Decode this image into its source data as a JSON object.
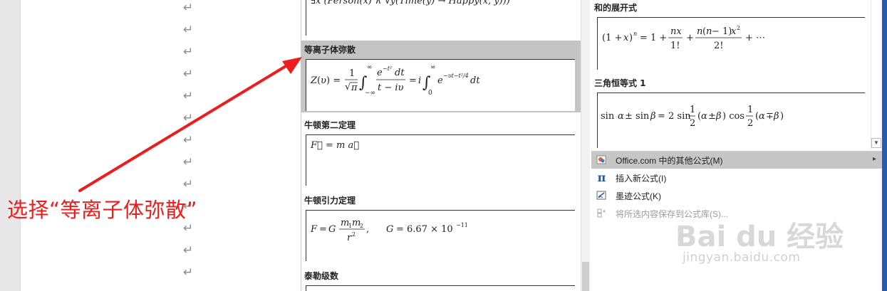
{
  "document": {
    "paragraph_mark": "↵",
    "annotation": "选择“等离子体弥散”"
  },
  "gallery": {
    "items": [
      {
        "title": "",
        "formula": "∃x (Person(x) ∧ ∀y(Time(y) → Happy(x, y)))"
      },
      {
        "title": "等离子体弥散",
        "formula": "Z(υ) = (1/√π) ∫₋∞^∞ e^(−t²) dt / (t − iυ) = i ∫₀^∞ e^(−υt − t²/4) dt"
      },
      {
        "title": "牛顿第二定理",
        "formula": "F⃗ = m a⃗"
      },
      {
        "title": "牛顿引力定理",
        "formula": "F = G m₁m₂ / r²,      G = 6.67 × 10⁻¹¹"
      },
      {
        "title": "泰勒级数",
        "formula": ""
      }
    ],
    "right_items": [
      {
        "title": "和的展开式",
        "formula": "(1 + x)ⁿ = 1 + nx/1! + n(n − 1)x²/2! + ⋯"
      },
      {
        "title": "三角恒等式 1",
        "formula": "sin α ± sin β = 2 sin ½(α ± β) cos ½(α ∓ β)"
      }
    ]
  },
  "menu": {
    "items": [
      {
        "label": "Office.com 中的其他公式(M)",
        "icon": "office-icon"
      },
      {
        "label": "插入新公式(I)",
        "icon": "pi-icon"
      },
      {
        "label": "墨迹公式(K)",
        "icon": "ink-equation-icon"
      },
      {
        "label": "将所选内容保存到公式库(S)...",
        "icon": "save-to-gallery-icon"
      }
    ],
    "submenu_arrow": "▸"
  },
  "watermark": {
    "logo_text": "Bai du 经验",
    "url": "jingyan.baidu.com"
  },
  "colors": {
    "annotation": "#ee1c1c",
    "selection": "#c4c4c4",
    "accent": "#2c5aa0"
  }
}
